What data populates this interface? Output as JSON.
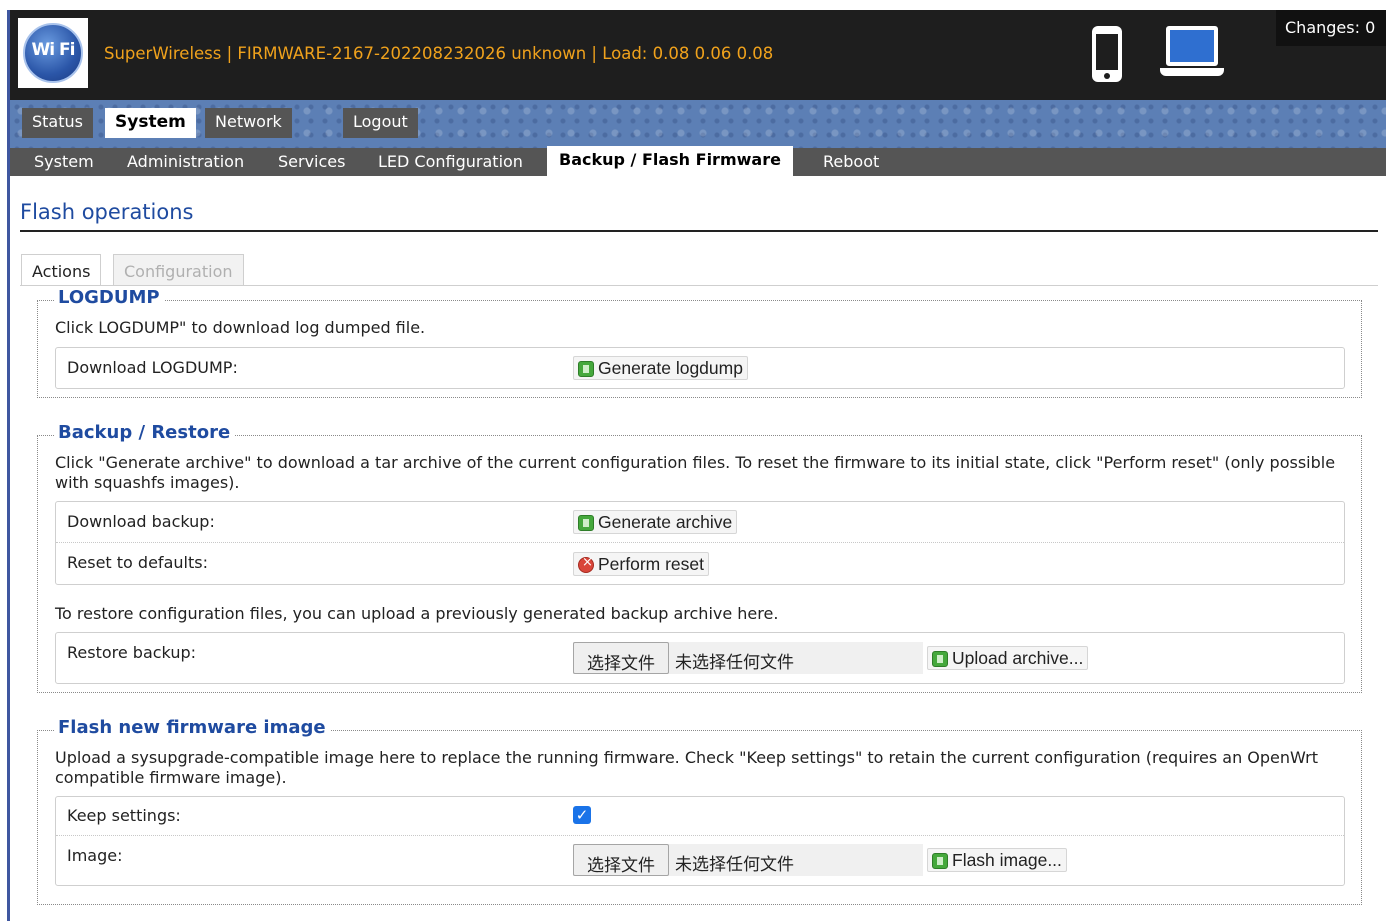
{
  "header": {
    "logo_text": "Wi Fi",
    "title": "SuperWireless | FIRMWARE-2167-202208232026 unknown | Load: 0.08 0.06 0.08",
    "changes": "Changes: 0"
  },
  "main_tabs": [
    {
      "label": "Status"
    },
    {
      "label": "System"
    },
    {
      "label": "Network"
    },
    {
      "label": "Logout"
    }
  ],
  "sub_tabs": [
    {
      "label": "System"
    },
    {
      "label": "Administration"
    },
    {
      "label": "Services"
    },
    {
      "label": "LED Configuration"
    },
    {
      "label": "Backup / Flash Firmware"
    },
    {
      "label": "Reboot"
    }
  ],
  "page": {
    "title": "Flash operations",
    "tabs": [
      {
        "label": "Actions"
      },
      {
        "label": "Configuration"
      }
    ]
  },
  "logdump": {
    "legend": "LOGDUMP",
    "description": "Click LOGDUMP\" to download log dumped file.",
    "row_label": "Download LOGDUMP:",
    "button": "Generate logdump"
  },
  "backup": {
    "legend": "Backup / Restore",
    "description": "Click \"Generate archive\" to download a tar archive of the current configuration files. To reset the firmware to its initial state, click \"Perform reset\" (only possible with squashfs images).",
    "download_label": "Download backup:",
    "download_button": "Generate archive",
    "reset_label": "Reset to defaults:",
    "reset_button": "Perform reset",
    "restore_description": "To restore configuration files, you can upload a previously generated backup archive here.",
    "restore_label": "Restore backup:",
    "file_button": "选择文件",
    "file_status": "未选择任何文件",
    "upload_button": "Upload archive..."
  },
  "flash": {
    "legend": "Flash new firmware image",
    "description": "Upload a sysupgrade-compatible image here to replace the running firmware. Check \"Keep settings\" to retain the current configuration (requires an OpenWrt compatible firmware image).",
    "keep_label": "Keep settings:",
    "keep_checked": true,
    "image_label": "Image:",
    "file_button": "选择文件",
    "file_status": "未选择任何文件",
    "flash_button": "Flash image..."
  }
}
